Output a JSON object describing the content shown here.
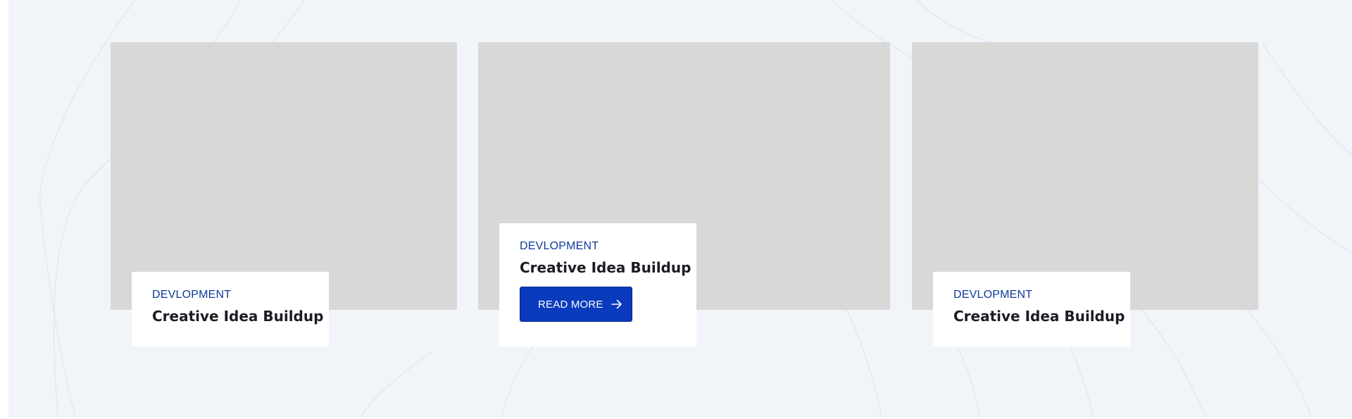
{
  "posts": [
    {
      "category": "DEVLOPMENT",
      "title": "Creative Idea Buildup"
    },
    {
      "category": "DEVLOPMENT",
      "title": "Creative Idea Buildup",
      "button_label": "READ MORE",
      "button_icon": "arrow-right-icon"
    },
    {
      "category": "DEVLOPMENT",
      "title": "Creative Idea Buildup"
    }
  ],
  "colors": {
    "background": "#f1f5fa",
    "image_placeholder": "#d8d8d8",
    "category": "#0d3a9c",
    "title": "#1c1c24",
    "button": "#0a3bbd"
  }
}
